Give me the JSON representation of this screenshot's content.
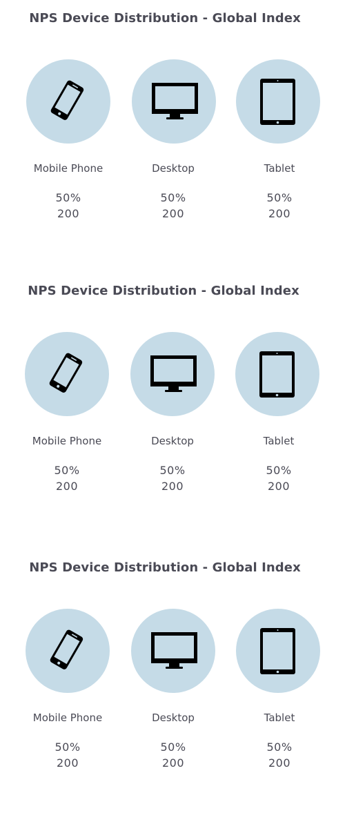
{
  "panels": [
    {
      "title": "NPS Device Distribution - Global Index",
      "devices": [
        {
          "label": "Mobile Phone",
          "icon": "mobile-phone-icon",
          "percent": "50%",
          "count": "200"
        },
        {
          "label": "Desktop",
          "icon": "desktop-monitor-icon",
          "percent": "50%",
          "count": "200"
        },
        {
          "label": "Tablet",
          "icon": "tablet-icon",
          "percent": "50%",
          "count": "200"
        }
      ]
    },
    {
      "title": "NPS Device Distribution - Global Index",
      "devices": [
        {
          "label": "Mobile Phone",
          "icon": "mobile-phone-icon",
          "percent": "50%",
          "count": "200"
        },
        {
          "label": "Desktop",
          "icon": "desktop-monitor-icon",
          "percent": "50%",
          "count": "200"
        },
        {
          "label": "Tablet",
          "icon": "tablet-icon",
          "percent": "50%",
          "count": "200"
        }
      ]
    },
    {
      "title": "NPS Device Distribution - Global Index",
      "devices": [
        {
          "label": "Mobile Phone",
          "icon": "mobile-phone-icon",
          "percent": "50%",
          "count": "200"
        },
        {
          "label": "Desktop",
          "icon": "desktop-monitor-icon",
          "percent": "50%",
          "count": "200"
        },
        {
          "label": "Tablet",
          "icon": "tablet-icon",
          "percent": "50%",
          "count": "200"
        }
      ]
    }
  ],
  "colors": {
    "circle_fill": "#c5dbe7",
    "icon": "#000000",
    "text": "#4a4a55"
  }
}
